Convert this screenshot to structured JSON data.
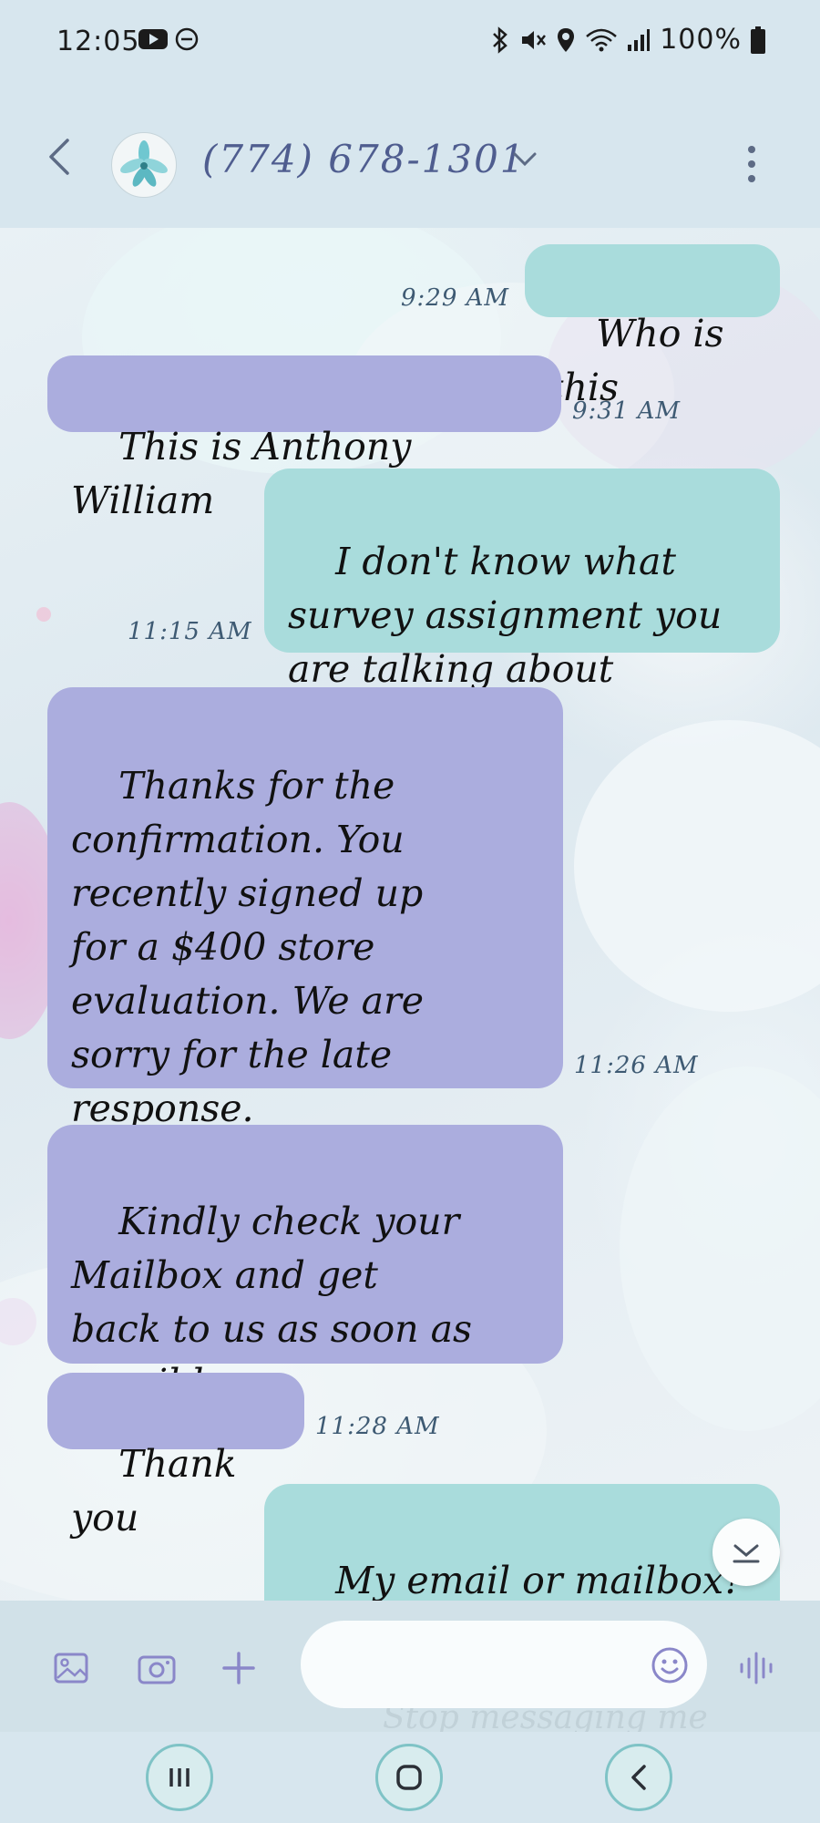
{
  "status_bar": {
    "time": "12:05",
    "battery": "100%",
    "icons": [
      "youtube-icon",
      "do-not-disturb-icon",
      "bluetooth-icon",
      "mute-icon",
      "location-icon",
      "wifi-icon",
      "signal-icon",
      "battery-icon"
    ]
  },
  "header": {
    "contact": "(774) 678-1301",
    "back_icon": "back-arrow-icon",
    "expand_icon": "chevron-down-icon",
    "menu_icon": "more-vert-icon"
  },
  "messages": [
    {
      "type": "sent",
      "text": "Who is this",
      "time": "9:29 AM"
    },
    {
      "type": "received",
      "text": "This is Anthony William",
      "time": "9:31 AM"
    },
    {
      "type": "sent",
      "text": "I don't know what\nsurvey assignment you\nare talking about",
      "time": "11:15 AM"
    },
    {
      "type": "received",
      "text": "Thanks for the\nconfirmation. You\nrecently signed up\nfor a $400 store\nevaluation. We are\nsorry for the late\nresponse.",
      "time": "11:26 AM"
    },
    {
      "type": "received",
      "text": "Kindly check your\nMailbox and get\nback to us as soon as\npossible",
      "time": ""
    },
    {
      "type": "received",
      "text": "Thank you",
      "time": "11:28 AM"
    },
    {
      "type": "sent",
      "text": "My email or mailbox?\nI didn't sign up for",
      "time": ""
    }
  ],
  "composer": {
    "ghost_text": "Stop messaging me",
    "icons": [
      "gallery-icon",
      "camera-icon",
      "add-icon",
      "emoji-icon",
      "voice-icon"
    ]
  },
  "nav": [
    "recents-button",
    "home-button",
    "back-button"
  ],
  "colors": {
    "received_bubble": "#abadde",
    "sent_bubble": "#a9dcdc",
    "timestamp": "#3e5a73",
    "contact_name": "#4f5d8f"
  }
}
